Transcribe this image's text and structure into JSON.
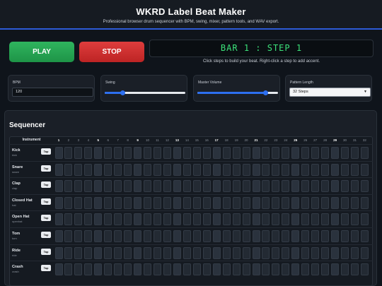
{
  "header": {
    "title": "WKRD Label Beat Maker",
    "subtitle": "Professional browser drum sequencer with BPM, swing, mixer, pattern tools, and WAV export."
  },
  "transport": {
    "play_label": "PLAY",
    "stop_label": "STOP",
    "display": "BAR 1 : STEP 1",
    "hint": "Click steps to build your beat. Right-click a step to add accent."
  },
  "controls": {
    "bpm": {
      "label": "BPM",
      "value": "120"
    },
    "swing": {
      "label": "Swing",
      "level": 0.22
    },
    "master_volume": {
      "label": "Master Volume",
      "level": 0.85
    },
    "pattern_length": {
      "label": "Pattern Length",
      "selected": "32 Steps"
    }
  },
  "sequencer": {
    "title": "Sequencer",
    "instrument_header": "Instrument",
    "tap_label": "Tap",
    "steps": [
      "1",
      "2",
      "3",
      "4",
      "5",
      "6",
      "7",
      "8",
      "9",
      "10",
      "11",
      "12",
      "13",
      "14",
      "15",
      "16",
      "17",
      "18",
      "19",
      "20",
      "21",
      "22",
      "23",
      "24",
      "25",
      "26",
      "27",
      "28",
      "29",
      "30",
      "31",
      "32"
    ],
    "instruments": [
      {
        "name": "Kick",
        "id": "kick"
      },
      {
        "name": "Snare",
        "id": "snare"
      },
      {
        "name": "Clap",
        "id": "clap"
      },
      {
        "name": "Closed Hat",
        "id": "hat"
      },
      {
        "name": "Open Hat",
        "id": "openhat"
      },
      {
        "name": "Tom",
        "id": "tom"
      },
      {
        "name": "Ride",
        "id": "ride"
      },
      {
        "name": "Crash",
        "id": "crash"
      }
    ]
  },
  "colors": {
    "accent": "#2d6ff0",
    "play": "#2fb45e",
    "stop": "#de3d3d",
    "display_text": "#3ce27a"
  }
}
